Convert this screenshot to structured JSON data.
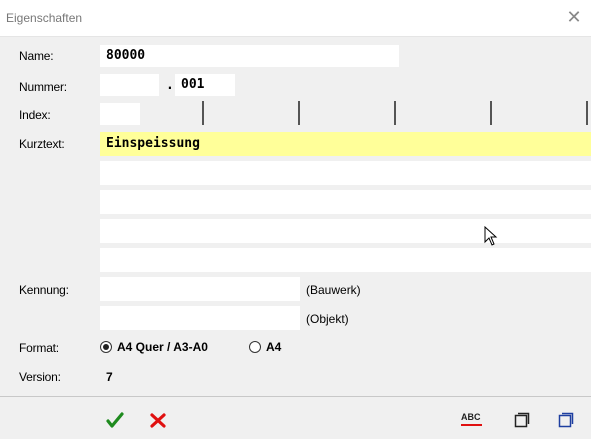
{
  "window": {
    "title": "Eigenschaften"
  },
  "labels": {
    "name": "Name:",
    "nummer": "Nummer:",
    "index": "Index:",
    "kurztext": "Kurztext:",
    "kennung": "Kennung:",
    "format": "Format:",
    "version": "Version:"
  },
  "fields": {
    "name": "80000",
    "nummer_left": "",
    "nummer_sep": ".",
    "nummer_right": "001",
    "index": "",
    "kurztext_lines": [
      "Einspeissung",
      "",
      "",
      "",
      ""
    ],
    "kennung_bauwerk": "",
    "kennung_objekt": ""
  },
  "kennung_suffix": {
    "bauwerk": "(Bauwerk)",
    "objekt": "(Objekt)"
  },
  "format": {
    "options": [
      "A4 Quer / A3-A0",
      "A4"
    ],
    "selected": "A4 Quer / A3-A0"
  },
  "version": "7",
  "toolbar": {
    "ok_icon": "check-icon",
    "cancel_icon": "x-icon",
    "spellcheck_label": "ABC",
    "window_icon": "window-icon",
    "window_alt_icon": "window-alt-icon"
  },
  "colors": {
    "highlight": "#ffff99",
    "ok": "#1f8b1f",
    "cancel": "#e01010",
    "window_icon": "#1e3fa0"
  }
}
